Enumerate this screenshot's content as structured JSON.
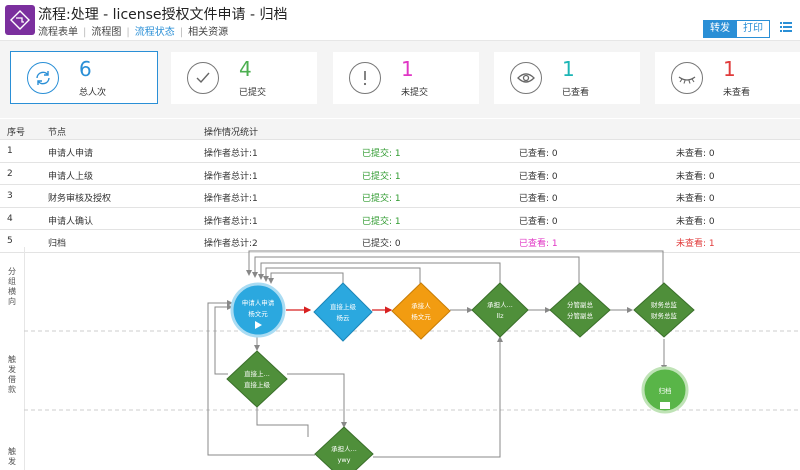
{
  "header": {
    "title": "流程:处理 - license授权文件申请 - 归档",
    "tabs": [
      "流程表单",
      "流程图",
      "流程状态",
      "相关资源"
    ],
    "active_tab": "流程状态",
    "forward_button": "转发",
    "print_button": "打印"
  },
  "stats": [
    {
      "value": "6",
      "label": "总人次",
      "color": "#2a8fd6",
      "icon": "refresh-icon"
    },
    {
      "value": "4",
      "label": "已提交",
      "color": "#4caf50",
      "icon": "check-icon"
    },
    {
      "value": "1",
      "label": "未提交",
      "color": "#e036c5",
      "icon": "exclamation-icon"
    },
    {
      "value": "1",
      "label": "已查看",
      "color": "#1cb5b5",
      "icon": "eye-icon"
    },
    {
      "value": "1",
      "label": "未查看",
      "color": "#e03b3b",
      "icon": "eye-closed-icon"
    }
  ],
  "table": {
    "headers": [
      "序号",
      "节点",
      "操作情况统计"
    ],
    "rows": [
      {
        "no": "1",
        "node": "申请人申请",
        "ops": "操作者总计:1",
        "submitted": "已提交: 1",
        "viewed": "已查看: 0",
        "unviewed": "未查看: 0"
      },
      {
        "no": "2",
        "node": "申请人上级",
        "ops": "操作者总计:1",
        "submitted": "已提交: 1",
        "viewed": "已查看: 0",
        "unviewed": "未查看: 0"
      },
      {
        "no": "3",
        "node": "财务审核及授权",
        "ops": "操作者总计:1",
        "submitted": "已提交: 1",
        "viewed": "已查看: 0",
        "unviewed": "未查看: 0"
      },
      {
        "no": "4",
        "node": "申请人确认",
        "ops": "操作者总计:1",
        "submitted": "已提交: 1",
        "viewed": "已查看: 0",
        "unviewed": "未查看: 0"
      },
      {
        "no": "5",
        "node": "归档",
        "ops": "操作者总计:2",
        "submitted": "已提交: 0",
        "viewed": "已查看: 1",
        "unviewed": "未查看: 1"
      }
    ]
  },
  "flow": {
    "lanes": [
      "分组横向",
      "触发借款",
      "触发"
    ],
    "nodes": {
      "n1": [
        "申请人申请",
        "杨文元"
      ],
      "n2": [
        "直接上级",
        "杨云"
      ],
      "n3": [
        "承接人",
        "杨文元"
      ],
      "n4": [
        "承担人...",
        "llz"
      ],
      "n5": [
        "分管副总",
        "分管副总"
      ],
      "n6": [
        "财务总监",
        "财务总监"
      ],
      "n7": [
        "直接上...",
        "直接上级"
      ],
      "n8": [
        "承担人...",
        "ywy"
      ],
      "n9": [
        "归档"
      ]
    }
  }
}
